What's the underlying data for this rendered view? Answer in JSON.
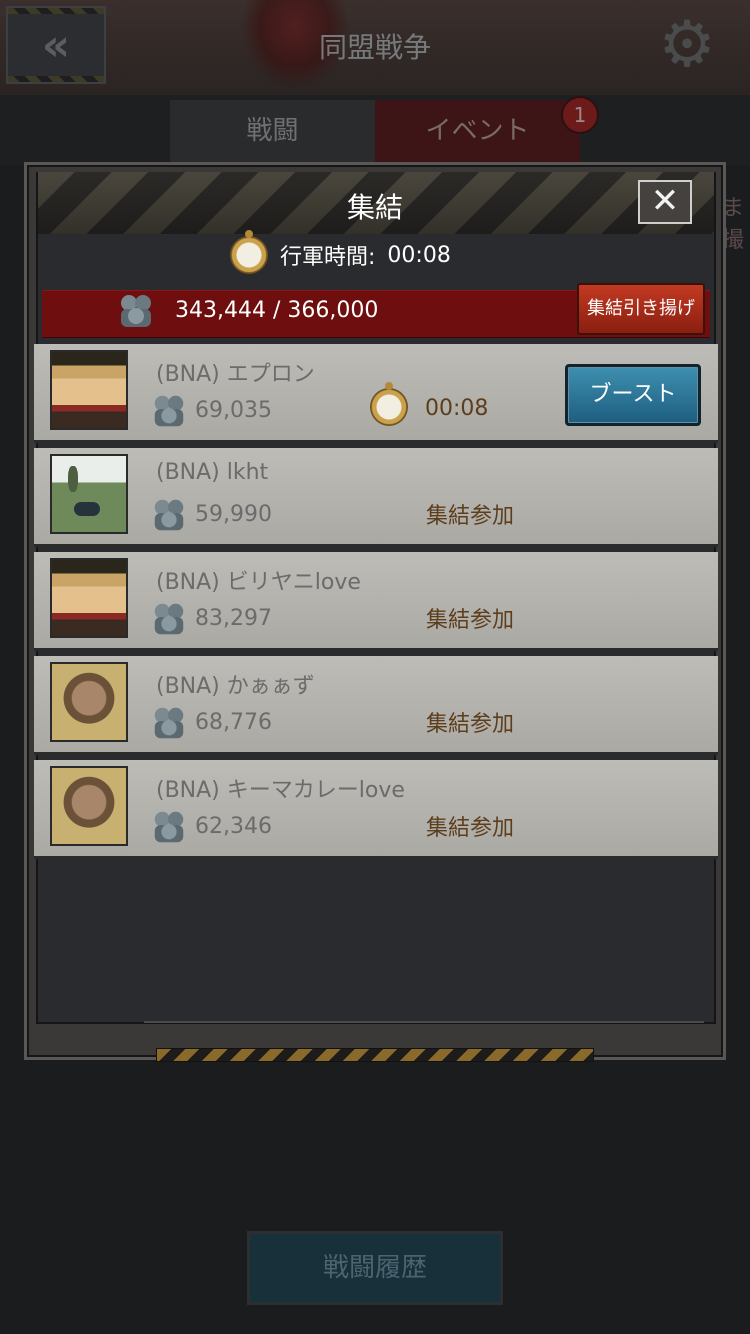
{
  "header": {
    "title": "同盟戦争",
    "back_icon": "double-chevron-left-icon",
    "gear_icon": "gear-icon"
  },
  "tabs": [
    {
      "label": "戦闘"
    },
    {
      "label": "イベント",
      "badge": "1"
    }
  ],
  "side_text": "ま撮",
  "history_button": "戦闘履歴",
  "modal": {
    "title": "集結",
    "close_label": "✕",
    "march_label": "行軍時間:",
    "march_time": "00:08",
    "troops": "343,444 / 366,000",
    "troop_ratio": 0.938,
    "recall_button": "集結引き揚げ",
    "members": [
      {
        "name": "(BNA) エプロン",
        "troops": "69,035",
        "time": "00:08",
        "action": "ブースト",
        "avatar": "woman-avatar"
      },
      {
        "name": "(BNA) lkht",
        "troops": "59,990",
        "status": "集結参加",
        "avatar": "field-avatar"
      },
      {
        "name": "(BNA) ビリヤニlove",
        "troops": "83,297",
        "status": "集結参加",
        "avatar": "woman-avatar"
      },
      {
        "name": "(BNA) かぁぁず",
        "troops": "68,776",
        "status": "集結参加",
        "avatar": "man-avatar"
      },
      {
        "name": "(BNA) キーマカレーlove",
        "troops": "62,346",
        "status": "集結参加",
        "avatar": "man-avatar"
      }
    ]
  },
  "colors": {
    "accent_red": "#6e0e0e",
    "boost_blue": "#2e7ea0",
    "recall_red": "#a82c18"
  }
}
